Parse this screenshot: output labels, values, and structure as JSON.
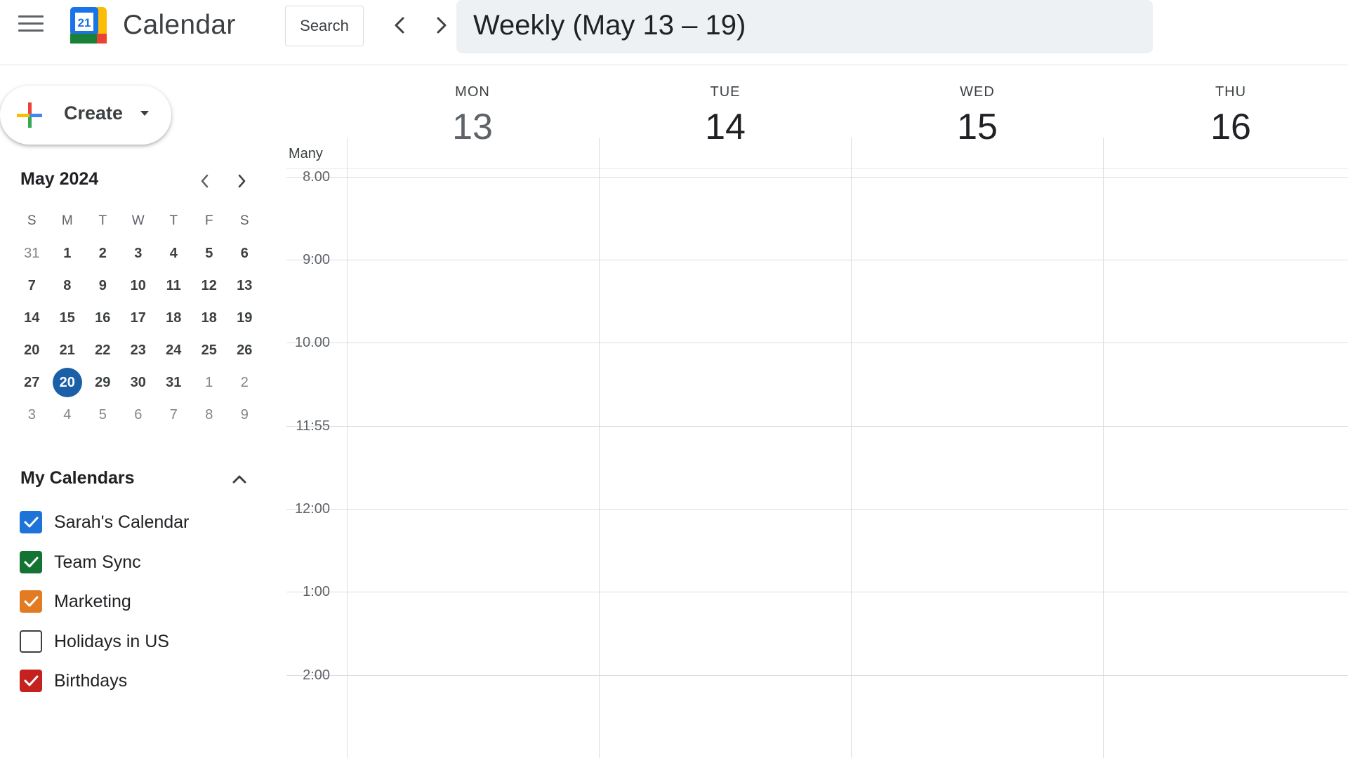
{
  "header": {
    "app_title": "Calendar",
    "logo_number": "21",
    "search_label": "Search",
    "date_range": "Weekly (May 13 – 19)",
    "icons": [
      "menu-icon",
      "chevron-left-icon",
      "chevron-right-icon"
    ]
  },
  "create": {
    "label": "Create"
  },
  "mini_calendar": {
    "month_label": "May 2024",
    "weekday_labels": [
      "S",
      "M",
      "T",
      "W",
      "T",
      "F",
      "S"
    ],
    "weeks": [
      [
        "31",
        "1",
        "2",
        "3",
        "4",
        "5",
        "6"
      ],
      [
        "7",
        "8",
        "9",
        "10",
        "11",
        "12",
        "13"
      ],
      [
        "14",
        "15",
        "16",
        "17",
        "18",
        "18",
        "19"
      ],
      [
        "20",
        "21",
        "22",
        "23",
        "24",
        "25",
        "26"
      ],
      [
        "27",
        "20",
        "29",
        "30",
        "31",
        "1",
        "2"
      ],
      [
        "3",
        "4",
        "5",
        "6",
        "7",
        "8",
        "9"
      ]
    ],
    "selected": "20",
    "selected_color": "#1a5fa8"
  },
  "my_calendars": {
    "title": "My Calendars",
    "items": [
      {
        "label": "Sarah's Calendar",
        "checked": true,
        "color": "#1e73d9"
      },
      {
        "label": "Team Sync",
        "checked": true,
        "color": "#137333"
      },
      {
        "label": "Marketing",
        "checked": true,
        "color": "#e37b22"
      },
      {
        "label": "Holidays in US",
        "checked": false,
        "color": "#3c4043"
      },
      {
        "label": "Birthdays",
        "checked": true,
        "color": "#c5221f"
      }
    ]
  },
  "week": {
    "timezone_label": "Many",
    "days": [
      {
        "name": "MON",
        "number": "13"
      },
      {
        "name": "TUE",
        "number": "14"
      },
      {
        "name": "WED",
        "number": "15"
      },
      {
        "name": "THU",
        "number": "16"
      }
    ],
    "time_labels": [
      "8.00",
      "9:00",
      "10.00",
      "11:55",
      "12:00",
      "1:00",
      "2:00"
    ]
  }
}
